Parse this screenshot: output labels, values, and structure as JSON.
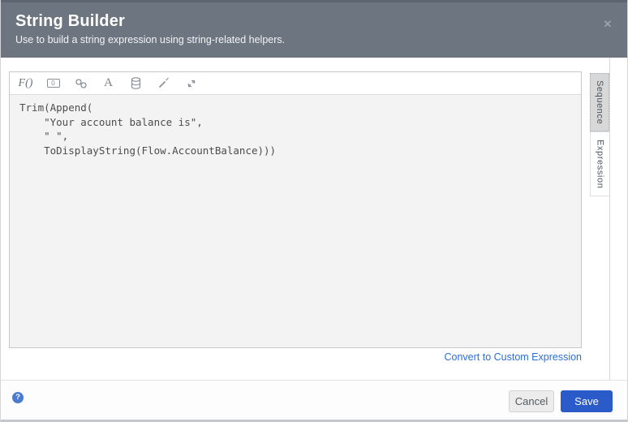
{
  "dialog": {
    "title": "String Builder",
    "subtitle": "Use to build a string expression using string-related helpers.",
    "close_symbol": "✕"
  },
  "toolbar": {
    "function_glyph": "F()",
    "constant_glyph": "0",
    "text_glyph": "A",
    "icons": [
      "function-icon",
      "constant-icon",
      "link-icon",
      "text-icon",
      "database-icon",
      "wand-icon",
      "expand-icon"
    ]
  },
  "editor": {
    "code": "Trim(Append(\n    \"Your account balance is\",\n    \" \",\n    ToDisplayString(Flow.AccountBalance)))"
  },
  "side_tabs": [
    {
      "label": "Sequence",
      "selected": true
    },
    {
      "label": "Expression",
      "selected": false
    }
  ],
  "links": {
    "convert": "Convert to Custom Expression"
  },
  "footer": {
    "help_symbol": "?",
    "cancel_label": "Cancel",
    "save_label": "Save"
  },
  "colors": {
    "header_bg": "#6d7680",
    "accent_blue": "#2a5bc8",
    "link_blue": "#2a6fd6",
    "editor_bg": "#f3f3f3",
    "tab_selected_bg": "#d8d8d8"
  }
}
